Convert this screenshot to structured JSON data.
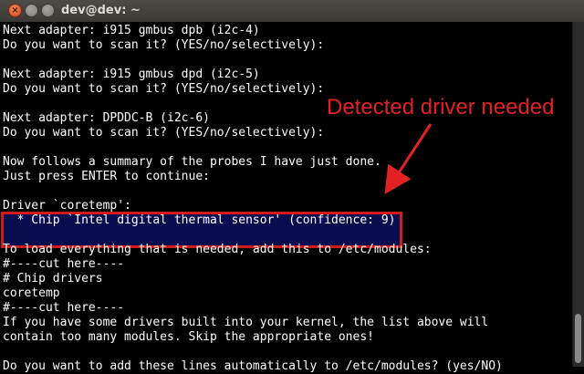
{
  "window": {
    "title": "dev@dev: ~",
    "close_glyph": "×"
  },
  "terminal": {
    "lines": [
      "Next adapter: i915 gmbus dpb (i2c-4)",
      "Do you want to scan it? (YES/no/selectively):",
      "",
      "Next adapter: i915 gmbus dpd (i2c-5)",
      "Do you want to scan it? (YES/no/selectively):",
      "",
      "Next adapter: DPDDC-B (i2c-6)",
      "Do you want to scan it? (YES/no/selectively):",
      "",
      "Now follows a summary of the probes I have just done.",
      "Just press ENTER to continue:",
      "",
      "Driver `coretemp':",
      "  * Chip `Intel digital thermal sensor' (confidence: 9)",
      "",
      "To load everything that is needed, add this to /etc/modules:",
      "#----cut here----",
      "# Chip drivers",
      "coretemp",
      "#----cut here----",
      "If you have some drivers built into your kernel, the list above will",
      "contain too many modules. Skip the appropriate ones!",
      "",
      "Do you want to add these lines automatically to /etc/modules? (yes/NO)"
    ]
  },
  "annotation": {
    "text": "Detected driver needed",
    "color": "#e22222"
  },
  "colors": {
    "terminal_bg": "#000000",
    "terminal_fg": "#ffffff",
    "highlight_border": "#d11b1b"
  }
}
